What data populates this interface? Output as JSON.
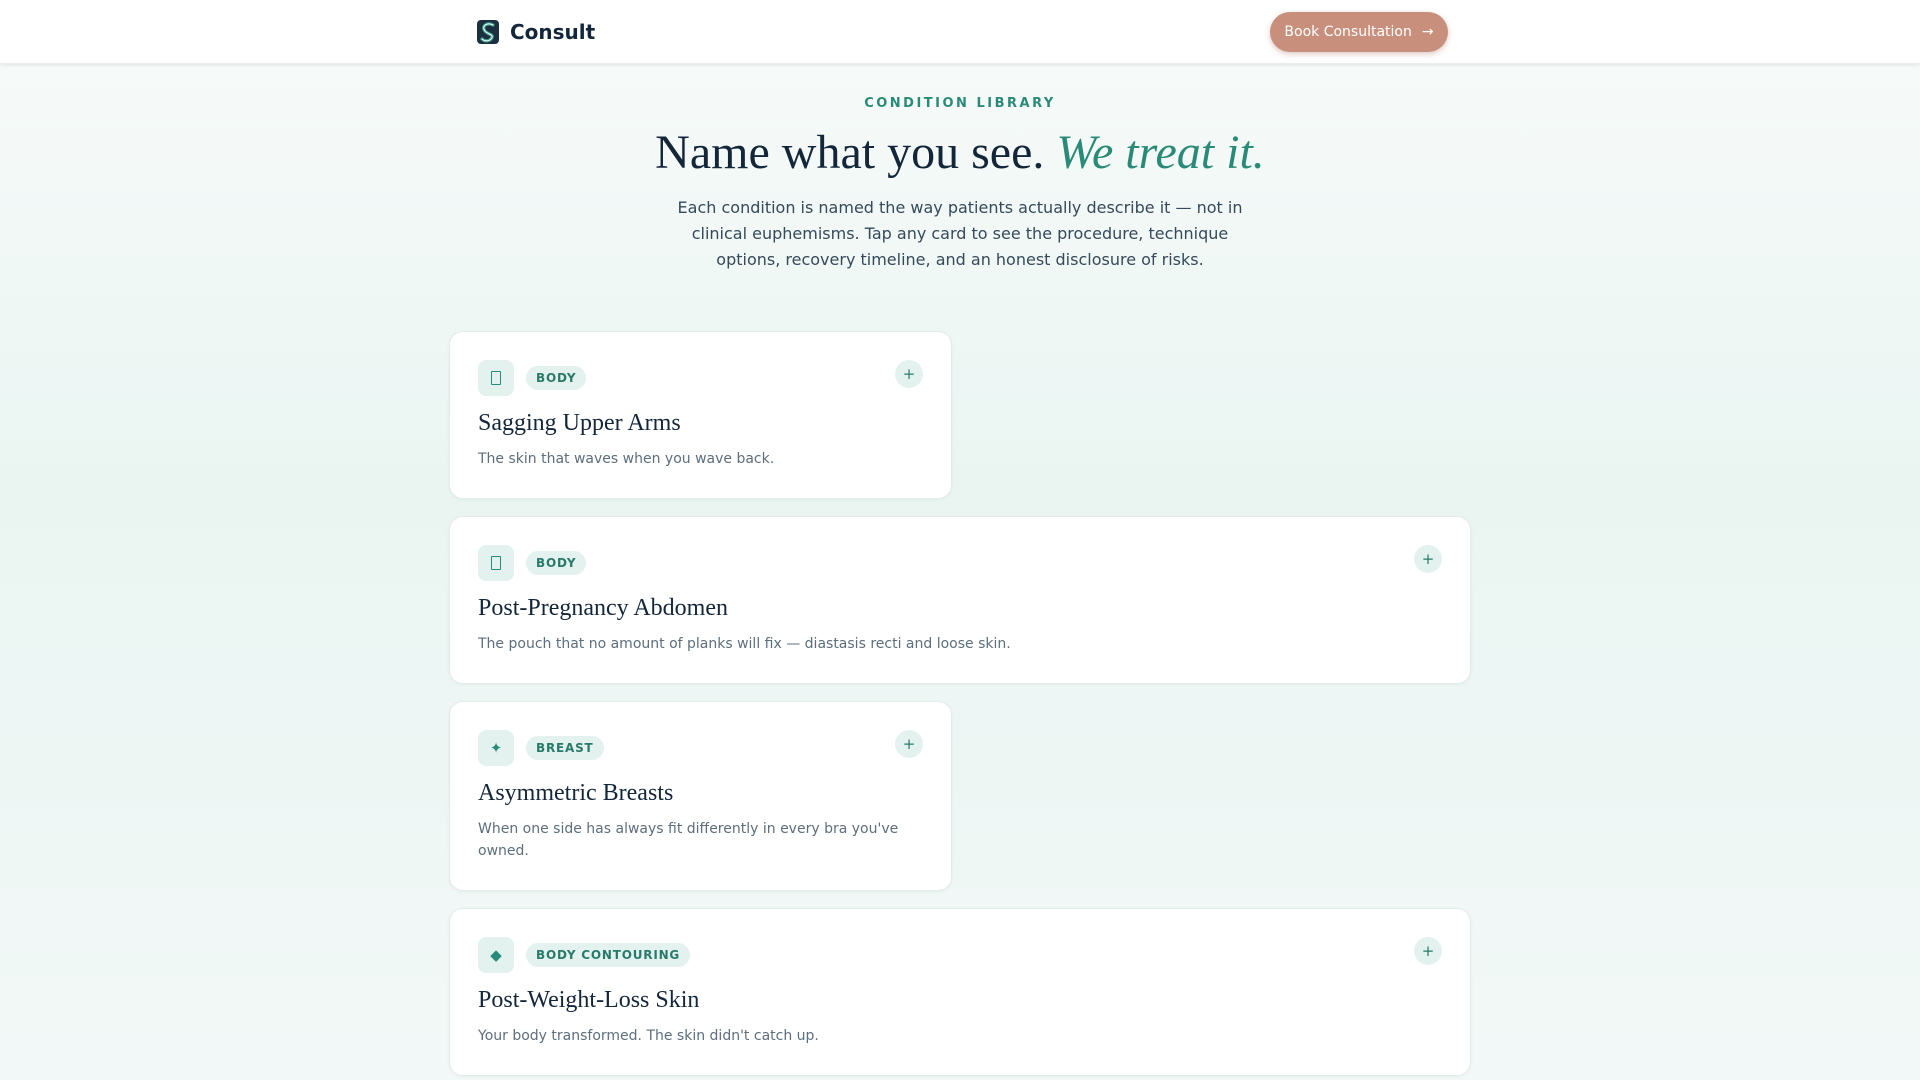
{
  "nav": {
    "brand": "Consult",
    "cta_label": "Book Consultation",
    "cta_icon": "arrow-right-icon"
  },
  "hero": {
    "eyebrow": "CONDITION LIBRARY",
    "headline_plain": "Name what you see.",
    "headline_accent": "We treat it.",
    "lead": "Each condition is named the way patients actually describe it — not in clinical euphemisms. Tap any card to see the procedure, technique options, recovery timeline, and an honest disclosure of risks."
  },
  "conditions": [
    {
      "tag": "BODY",
      "icon": "outline-square-icon",
      "title": "Sagging Upper Arms",
      "desc": "The skin that waves when you wave back."
    },
    {
      "tag": "BODY",
      "icon": "outline-square-icon",
      "title": "Post-Pregnancy Abdomen",
      "desc": "The pouch that no amount of planks will fix — diastasis recti and loose skin."
    },
    {
      "tag": "BREAST",
      "icon": "sparkle-icon",
      "title": "Asymmetric Breasts",
      "desc": "When one side has always fit differently in every bra you've owned."
    },
    {
      "tag": "BODY CONTOURING",
      "icon": "diamond-icon",
      "title": "Post-Weight-Loss Skin",
      "desc": "Your body transformed. The skin didn't catch up."
    }
  ],
  "expand_symbol": "+",
  "colors": {
    "accent": "#2a8a78",
    "cta": "#c78f7c",
    "ink": "#13263a",
    "tag_bg": "#e3f2ee"
  }
}
